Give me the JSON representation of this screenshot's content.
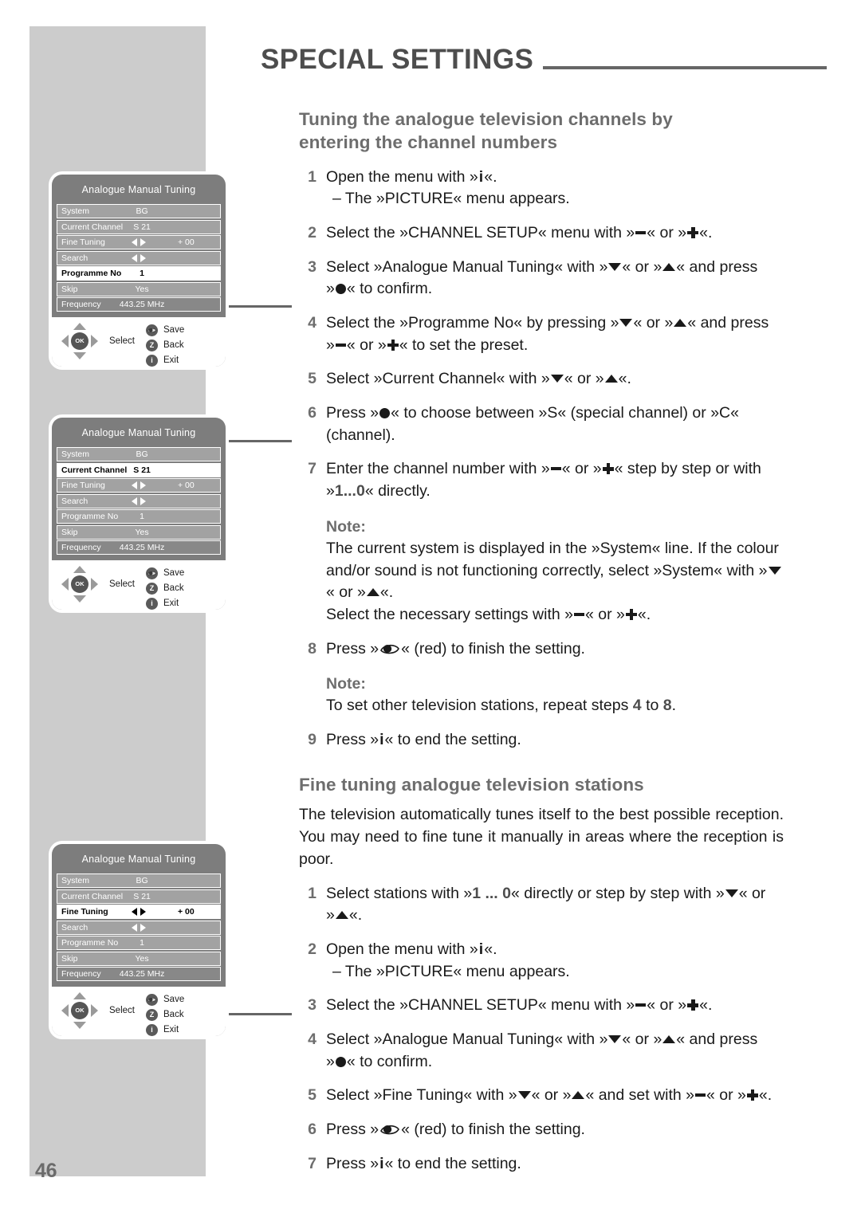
{
  "header": {
    "chapter_title": "SPECIAL SETTINGS",
    "page_number": "46"
  },
  "sections": [
    {
      "heading": "Tuning the analogue television channels by entering the channel numbers",
      "steps": [
        {
          "num": "1",
          "text": "Open the menu with »i«.",
          "sub": "– The »PICTURE« menu appears."
        },
        {
          "num": "2",
          "text": "Select the »CHANNEL SETUP« menu with »–« or »+«."
        },
        {
          "num": "3",
          "text": "Select »Analogue Manual Tuning« with »v« or »^« and press »●« to confirm."
        },
        {
          "num": "4",
          "text": "Select the »Programme No« by pressing »v« or »^« and press »–« or »+« to set the preset."
        },
        {
          "num": "5",
          "text": "Select »Current Channel« with »v« or »^«."
        },
        {
          "num": "6",
          "text": "Press »●« to choose between »S« (special channel) or »C« (channel)."
        },
        {
          "num": "7",
          "text": "Enter the channel number with »–« or »+« step by step or with »1...0« directly."
        },
        {
          "num": "8",
          "text": "Press »👁« (red) to finish the setting."
        },
        {
          "num": "9",
          "text": "Press »i« to end the setting."
        }
      ],
      "notes": [
        {
          "title": "Note:",
          "body": "The current system is displayed in the »System« line. If the colour and/or sound is not functioning correctly, select »System« with »v« or »^«. Select the necessary settings with »–« or »+«."
        },
        {
          "title": "Note:",
          "body": "To set other television stations, repeat steps 4 to 8."
        }
      ]
    },
    {
      "heading": "Fine tuning analogue television stations",
      "intro": "The television automatically tunes itself to the best possible reception. You may need to fine tune it manually in areas where the reception is poor.",
      "steps": [
        {
          "num": "1",
          "text": "Select stations with »1 ... 0« directly or step by step with »v« or »^«."
        },
        {
          "num": "2",
          "text": "Open the menu with »i«.",
          "sub": "– The »PICTURE« menu appears."
        },
        {
          "num": "3",
          "text": "Select the »CHANNEL SETUP« menu with »–« or »+«."
        },
        {
          "num": "4",
          "text": "Select »Analogue Manual Tuning« with »v« or »^« and press »●« to confirm."
        },
        {
          "num": "5",
          "text": "Select »Fine Tuning« with »v« or »^« and set with »–« or »+«."
        },
        {
          "num": "6",
          "text": "Press »👁« (red) to finish the setting."
        },
        {
          "num": "7",
          "text": "Press »i« to end the setting."
        }
      ]
    }
  ],
  "osd_menus": [
    {
      "id": "menu-programme-no",
      "title": "Analogue Manual Tuning",
      "selected_row": "Programme No",
      "rows": [
        {
          "label": "System",
          "value": "BG"
        },
        {
          "label": "Current Channel",
          "value": "S 21"
        },
        {
          "label": "Fine Tuning",
          "value": "+ 00",
          "arrows": true
        },
        {
          "label": "Search",
          "value": "",
          "arrows": true
        },
        {
          "label": "Programme No",
          "value": "1"
        },
        {
          "label": "Skip",
          "value": "Yes"
        },
        {
          "label": "Frequency",
          "value": "443.25 MHz",
          "dark": true
        }
      ],
      "footer": {
        "select_label": "Select",
        "keys": [
          {
            "icon": "eye-icon",
            "glyph": "",
            "label": "Save"
          },
          {
            "icon": "z-button-icon",
            "glyph": "Z",
            "label": "Back"
          },
          {
            "icon": "info-button-icon",
            "glyph": "i",
            "label": "Exit"
          }
        ]
      }
    },
    {
      "id": "menu-current-channel",
      "title": "Analogue Manual Tuning",
      "selected_row": "Current Channel",
      "rows": [
        {
          "label": "System",
          "value": "BG"
        },
        {
          "label": "Current Channel",
          "value": "S 21"
        },
        {
          "label": "Fine Tuning",
          "value": "+ 00",
          "arrows": true
        },
        {
          "label": "Search",
          "value": "",
          "arrows": true
        },
        {
          "label": "Programme No",
          "value": "1"
        },
        {
          "label": "Skip",
          "value": "Yes"
        },
        {
          "label": "Frequency",
          "value": "443.25 MHz",
          "dark": true
        }
      ],
      "footer": {
        "select_label": "Select",
        "keys": [
          {
            "icon": "eye-icon",
            "glyph": "",
            "label": "Save"
          },
          {
            "icon": "z-button-icon",
            "glyph": "Z",
            "label": "Back"
          },
          {
            "icon": "info-button-icon",
            "glyph": "i",
            "label": "Exit"
          }
        ]
      }
    },
    {
      "id": "menu-fine-tuning",
      "title": "Analogue Manual Tuning",
      "selected_row": "Fine Tuning",
      "rows": [
        {
          "label": "System",
          "value": "BG"
        },
        {
          "label": "Current Channel",
          "value": "S 21"
        },
        {
          "label": "Fine Tuning",
          "value": "+ 00",
          "arrows": true
        },
        {
          "label": "Search",
          "value": "",
          "arrows": true
        },
        {
          "label": "Programme No",
          "value": "1"
        },
        {
          "label": "Skip",
          "value": "Yes"
        },
        {
          "label": "Frequency",
          "value": "443.25 MHz",
          "dark": true
        }
      ],
      "footer": {
        "select_label": "Select",
        "keys": [
          {
            "icon": "eye-icon",
            "glyph": "",
            "label": "Save"
          },
          {
            "icon": "z-button-icon",
            "glyph": "Z",
            "label": "Back"
          },
          {
            "icon": "info-button-icon",
            "glyph": "i",
            "label": "Exit"
          }
        ]
      }
    }
  ],
  "colors": {
    "sidebar": "#cccccc",
    "heading_grey": "#6d6d6d",
    "osd_panel": "#7d7d7d",
    "osd_row": "#a2a2a2",
    "osd_row_dark": "#888888",
    "rule": "#666666"
  }
}
